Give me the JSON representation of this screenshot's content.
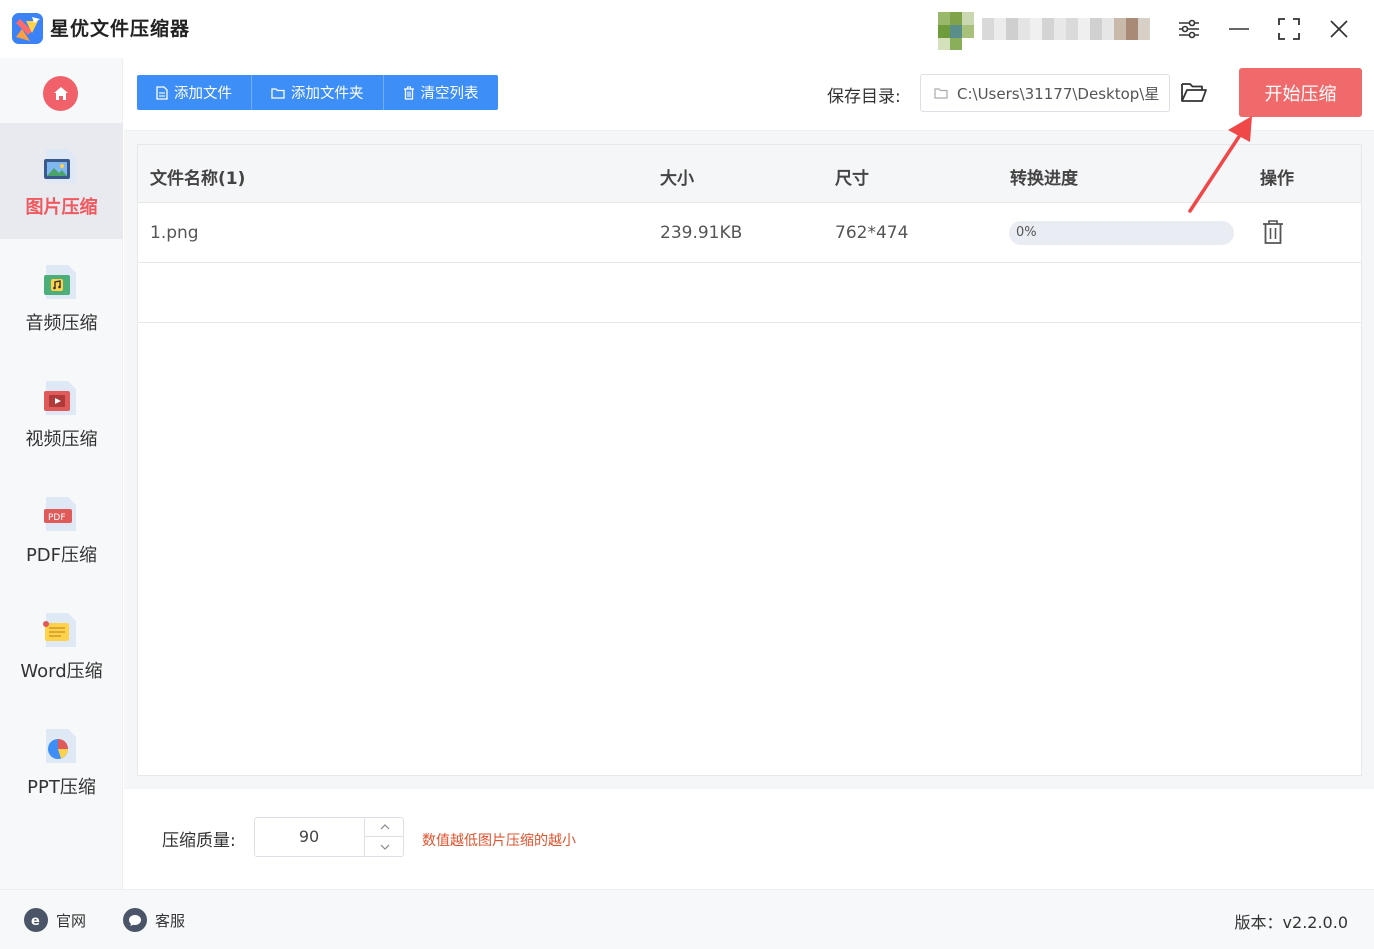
{
  "app": {
    "title": "星优文件压缩器"
  },
  "window_controls": [
    "settings-icon",
    "minimize-icon",
    "maximize-icon",
    "close-icon"
  ],
  "sidebar": {
    "items": [
      {
        "label": "图片压缩",
        "icon": "image-file-icon",
        "active": true
      },
      {
        "label": "音频压缩",
        "icon": "audio-file-icon",
        "active": false
      },
      {
        "label": "视频压缩",
        "icon": "video-file-icon",
        "active": false
      },
      {
        "label": "PDF压缩",
        "icon": "pdf-file-icon",
        "active": false
      },
      {
        "label": "Word压缩",
        "icon": "word-file-icon",
        "active": false
      },
      {
        "label": "PPT压缩",
        "icon": "ppt-file-icon",
        "active": false
      }
    ]
  },
  "toolbar": {
    "add_file": "添加文件",
    "add_folder": "添加文件夹",
    "clear_list": "清空列表",
    "save_dir_label": "保存目录:",
    "save_dir_value": "C:\\Users\\31177\\Desktop\\星",
    "start_button": "开始压缩"
  },
  "table": {
    "headers": {
      "name": "文件名称(1)",
      "size": "大小",
      "dimensions": "尺寸",
      "progress": "转换进度",
      "action": "操作"
    },
    "rows": [
      {
        "name": "1.png",
        "size": "239.91KB",
        "dimensions": "762*474",
        "progress_text": "0%",
        "progress_value": 0
      }
    ]
  },
  "settings": {
    "quality_label": "压缩质量:",
    "quality_value": "90",
    "quality_hint": "数值越低图片压缩的越小"
  },
  "footer": {
    "website": "官网",
    "support": "客服",
    "version": "版本：v2.2.0.0"
  },
  "colors": {
    "accent_red": "#f06a6b",
    "primary_blue": "#3e8ef7",
    "hint_orange": "#e0522c"
  }
}
